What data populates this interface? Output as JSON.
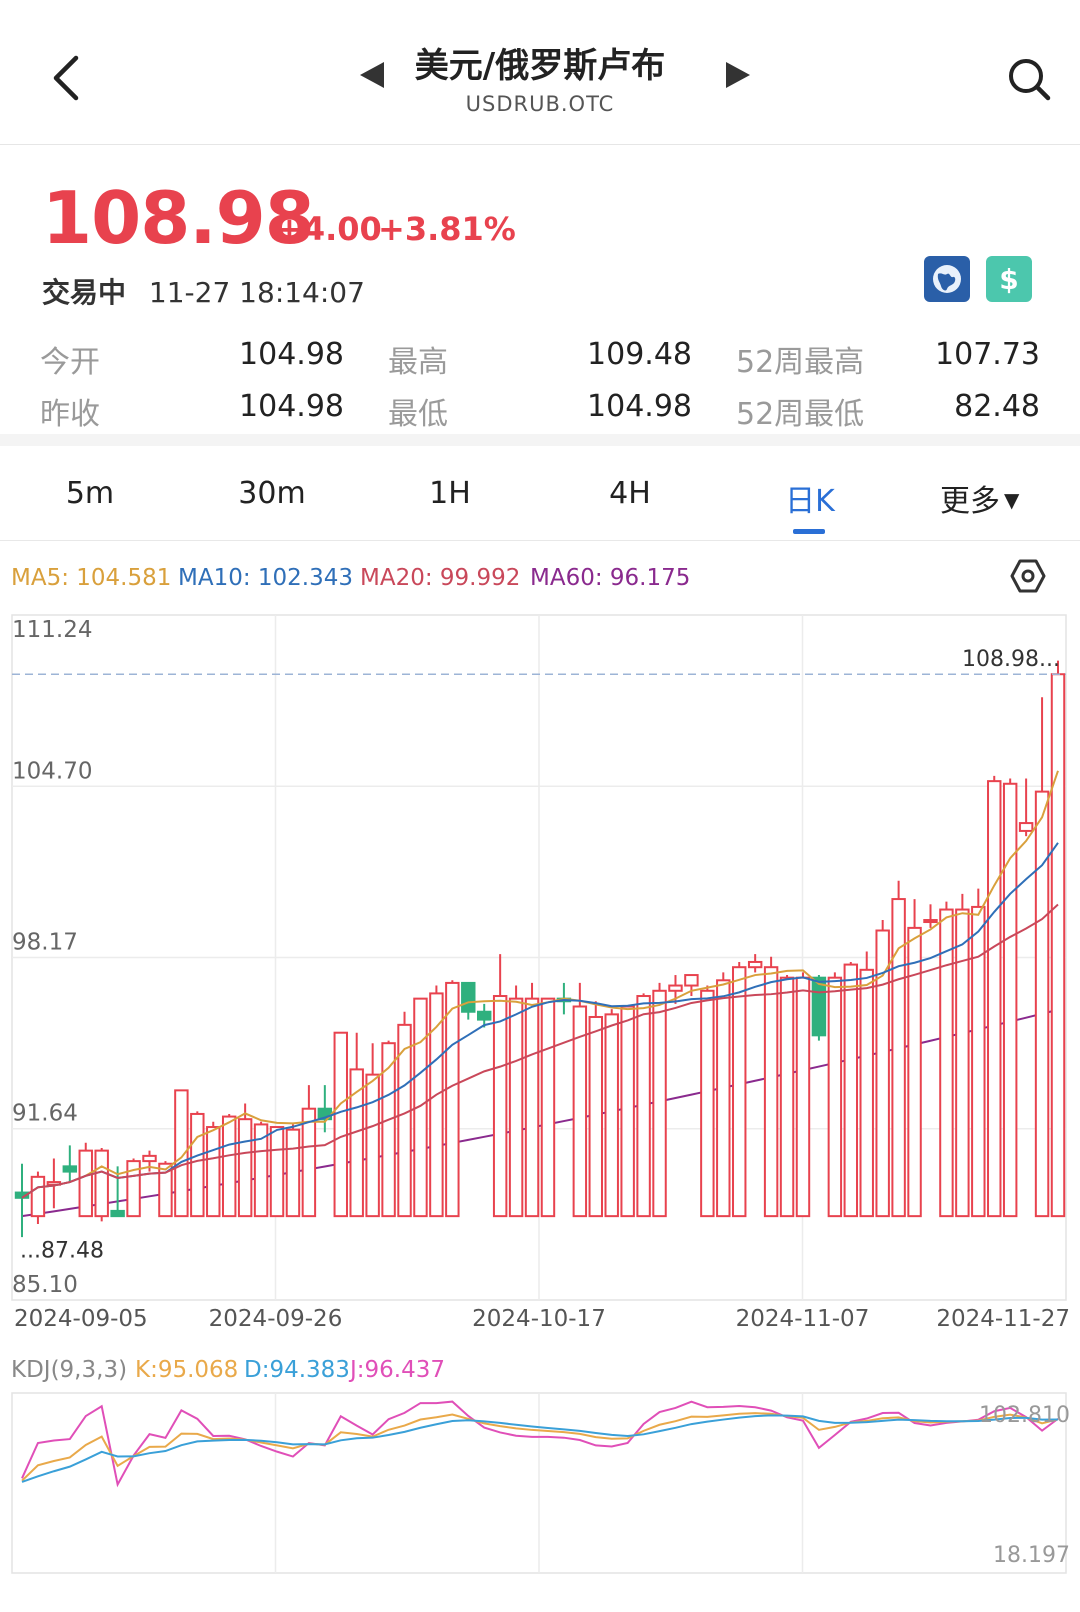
{
  "header": {
    "title": "美元/俄罗斯卢布",
    "subtitle": "USDRUB.OTC"
  },
  "quote": {
    "price": "108.98",
    "change": "+4.00",
    "change_pct": "+3.81%",
    "status": "交易中",
    "time": "11-27 18:14:07"
  },
  "stats": [
    {
      "label": "今开",
      "value": "104.98"
    },
    {
      "label": "最高",
      "value": "109.48"
    },
    {
      "label": "52周最高",
      "value": "107.73"
    },
    {
      "label": "昨收",
      "value": "104.98"
    },
    {
      "label": "最低",
      "value": "104.98"
    },
    {
      "label": "52周最低",
      "value": "82.48"
    }
  ],
  "tabs": [
    "5m",
    "30m",
    "1H",
    "4H",
    "日K",
    "更多"
  ],
  "active_tab": "日K",
  "indicators": {
    "ma5": "MA5: 104.581",
    "ma10": "MA10: 102.343",
    "ma20": "MA20: 99.992",
    "ma60": "MA60: 96.175"
  },
  "kdj": {
    "name": "KDJ(9,3,3)",
    "k": "K:95.068",
    "d": "D:94.383",
    "j": "J:96.437"
  },
  "colors": {
    "up": "#e8424e",
    "down": "#2fb07e",
    "ma5": "#d9a03c",
    "ma10": "#2f6fb8",
    "ma20": "#c9485a",
    "ma60": "#8a2a8e",
    "k": "#e9a94a",
    "d": "#3aa0d8",
    "j": "#e04fb8",
    "accent": "#2a6fd6"
  },
  "chart_data": {
    "type": "candlestick",
    "y_axis_ticks": [
      "111.24",
      "104.70",
      "98.17",
      "91.64",
      "85.10"
    ],
    "ylim": [
      85.1,
      111.24
    ],
    "x_axis_ticks": [
      "2024-09-05",
      "2024-09-26",
      "2024-10-17",
      "2024-11-07",
      "2024-11-27"
    ],
    "last_price_label": "108.98...",
    "min_label": "...87.48",
    "kdj_axis": [
      "102.810",
      "18.197"
    ],
    "candles": [
      {
        "o": 89.2,
        "h": 90.3,
        "l": 87.5,
        "c": 89.0
      },
      {
        "o": 88.3,
        "h": 90.0,
        "l": 88.0,
        "c": 89.8
      },
      {
        "o": 89.5,
        "h": 90.5,
        "l": 88.6,
        "c": 89.6
      },
      {
        "o": 90.2,
        "h": 91.0,
        "l": 89.6,
        "c": 90.0
      },
      {
        "o": 88.3,
        "h": 91.1,
        "l": 88.3,
        "c": 90.8
      },
      {
        "o": 88.3,
        "h": 90.9,
        "l": 88.1,
        "c": 90.8
      },
      {
        "o": 88.5,
        "h": 90.2,
        "l": 88.3,
        "c": 88.3
      },
      {
        "o": 88.3,
        "h": 90.5,
        "l": 88.3,
        "c": 90.4
      },
      {
        "o": 90.4,
        "h": 90.8,
        "l": 90.0,
        "c": 90.6
      },
      {
        "o": 88.3,
        "h": 90.4,
        "l": 88.3,
        "c": 90.3
      },
      {
        "o": 88.3,
        "h": 93.1,
        "l": 88.3,
        "c": 93.1
      },
      {
        "o": 88.3,
        "h": 92.3,
        "l": 88.3,
        "c": 92.2
      },
      {
        "o": 88.3,
        "h": 91.9,
        "l": 88.3,
        "c": 91.7
      },
      {
        "o": 88.3,
        "h": 92.2,
        "l": 88.3,
        "c": 92.1
      },
      {
        "o": 88.3,
        "h": 92.6,
        "l": 88.3,
        "c": 92.0
      },
      {
        "o": 88.3,
        "h": 91.9,
        "l": 88.3,
        "c": 91.8
      },
      {
        "o": 88.3,
        "h": 91.7,
        "l": 88.3,
        "c": 91.7
      },
      {
        "o": 88.3,
        "h": 91.8,
        "l": 88.3,
        "c": 91.6
      },
      {
        "o": 88.3,
        "h": 93.3,
        "l": 88.3,
        "c": 92.4
      },
      {
        "o": 92.4,
        "h": 93.3,
        "l": 91.5,
        "c": 92.0
      },
      {
        "o": 88.3,
        "h": 95.3,
        "l": 88.3,
        "c": 95.3
      },
      {
        "o": 88.3,
        "h": 95.3,
        "l": 88.3,
        "c": 93.9
      },
      {
        "o": 88.3,
        "h": 94.9,
        "l": 88.3,
        "c": 93.7
      },
      {
        "o": 88.3,
        "h": 95.0,
        "l": 88.3,
        "c": 94.9
      },
      {
        "o": 88.3,
        "h": 96.1,
        "l": 88.3,
        "c": 95.6
      },
      {
        "o": 88.3,
        "h": 96.6,
        "l": 88.3,
        "c": 96.6
      },
      {
        "o": 88.3,
        "h": 97.1,
        "l": 88.3,
        "c": 96.8
      },
      {
        "o": 88.3,
        "h": 97.3,
        "l": 88.3,
        "c": 97.2
      },
      {
        "o": 97.2,
        "h": 97.2,
        "l": 95.8,
        "c": 96.1
      },
      {
        "o": 96.1,
        "h": 96.4,
        "l": 95.5,
        "c": 95.8
      },
      {
        "o": 88.3,
        "h": 98.3,
        "l": 88.3,
        "c": 96.7
      },
      {
        "o": 88.3,
        "h": 97.1,
        "l": 88.3,
        "c": 96.6
      },
      {
        "o": 88.3,
        "h": 97.2,
        "l": 88.3,
        "c": 96.6
      },
      {
        "o": 88.3,
        "h": 96.6,
        "l": 88.3,
        "c": 96.6
      },
      {
        "o": 96.6,
        "h": 97.2,
        "l": 96.0,
        "c": 96.5
      },
      {
        "o": 88.3,
        "h": 97.2,
        "l": 88.3,
        "c": 96.3
      },
      {
        "o": 88.3,
        "h": 96.5,
        "l": 88.3,
        "c": 95.9
      },
      {
        "o": 88.3,
        "h": 96.2,
        "l": 88.3,
        "c": 96.0
      },
      {
        "o": 88.3,
        "h": 96.3,
        "l": 88.3,
        "c": 96.3
      },
      {
        "o": 88.3,
        "h": 96.8,
        "l": 88.3,
        "c": 96.7
      },
      {
        "o": 88.3,
        "h": 97.2,
        "l": 88.3,
        "c": 96.9
      },
      {
        "o": 96.9,
        "h": 97.5,
        "l": 96.4,
        "c": 97.1
      },
      {
        "o": 97.1,
        "h": 97.4,
        "l": 96.7,
        "c": 97.5
      },
      {
        "o": 88.3,
        "h": 97.1,
        "l": 88.3,
        "c": 96.9
      },
      {
        "o": 88.3,
        "h": 97.6,
        "l": 88.3,
        "c": 97.3
      },
      {
        "o": 88.3,
        "h": 98.0,
        "l": 88.3,
        "c": 97.8
      },
      {
        "o": 97.8,
        "h": 98.3,
        "l": 97.6,
        "c": 98.0
      },
      {
        "o": 88.3,
        "h": 98.2,
        "l": 88.3,
        "c": 97.8
      },
      {
        "o": 88.3,
        "h": 97.5,
        "l": 88.3,
        "c": 97.4
      },
      {
        "o": 88.3,
        "h": 97.6,
        "l": 88.3,
        "c": 97.4
      },
      {
        "o": 97.4,
        "h": 97.5,
        "l": 95.0,
        "c": 95.2
      },
      {
        "o": 88.3,
        "h": 97.6,
        "l": 88.3,
        "c": 97.4
      },
      {
        "o": 88.3,
        "h": 98.0,
        "l": 88.3,
        "c": 97.9
      },
      {
        "o": 88.3,
        "h": 98.4,
        "l": 88.3,
        "c": 97.7
      },
      {
        "o": 88.3,
        "h": 99.6,
        "l": 88.3,
        "c": 99.2
      },
      {
        "o": 88.3,
        "h": 101.1,
        "l": 88.3,
        "c": 100.4
      },
      {
        "o": 88.3,
        "h": 100.4,
        "l": 88.3,
        "c": 99.3
      },
      {
        "o": 99.6,
        "h": 100.2,
        "l": 99.3,
        "c": 99.6
      },
      {
        "o": 88.3,
        "h": 100.3,
        "l": 88.3,
        "c": 100.0
      },
      {
        "o": 88.3,
        "h": 100.6,
        "l": 88.3,
        "c": 100.0
      },
      {
        "o": 88.3,
        "h": 100.8,
        "l": 88.3,
        "c": 100.1
      },
      {
        "o": 88.3,
        "h": 105.1,
        "l": 88.3,
        "c": 104.9
      },
      {
        "o": 88.3,
        "h": 105.0,
        "l": 88.3,
        "c": 104.8
      },
      {
        "o": 103.0,
        "h": 105.0,
        "l": 102.8,
        "c": 103.3
      },
      {
        "o": 88.3,
        "h": 108.1,
        "l": 88.3,
        "c": 104.5
      },
      {
        "o": 88.3,
        "h": 109.5,
        "l": 88.3,
        "c": 108.98
      }
    ]
  }
}
